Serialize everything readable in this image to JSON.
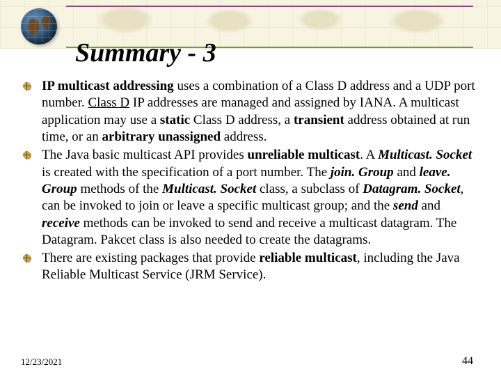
{
  "title": "Summary - 3",
  "bullets": [
    {
      "html": "<b>IP multicast addressing</b> uses a combination of a Class D address and a UDP port number. <u>Class D</u> IP addresses are managed and assigned by IANA.  A multicast application may use a <b>static</b> Class D address, a <b>transient</b> address obtained at run time, or an <b>arbitrary unassigned</b> address."
    },
    {
      "html": "The Java basic multicast API provides <b>unreliable multicast</b>.  A <b><i>Multicast. Socket</i></b> is created with the specification of a port number.  The <b><i>join. Group</i></b> and <b><i>leave. Group</i></b> methods of the <b><i>Multicast. Socket</i></b> class, a subclass of <b><i>Datagram. Socket</i></b>, can be invoked to join or leave a specific multicast group; and the <b><i>send</i></b> and <b><i>receive</i></b> methods can be invoked to send and receive a multicast datagram.  The Datagram. Pakcet class is also needed to create the datagrams."
    },
    {
      "html": "There are existing packages that provide <b>reliable multicast</b>, including the Java Reliable Multicast Service (JRM Service)."
    }
  ],
  "footer": {
    "date": "12/23/2021",
    "page": "44"
  },
  "colors": {
    "bullet_fill": "#caa84a",
    "bullet_shadow": "#5a4a1a"
  }
}
